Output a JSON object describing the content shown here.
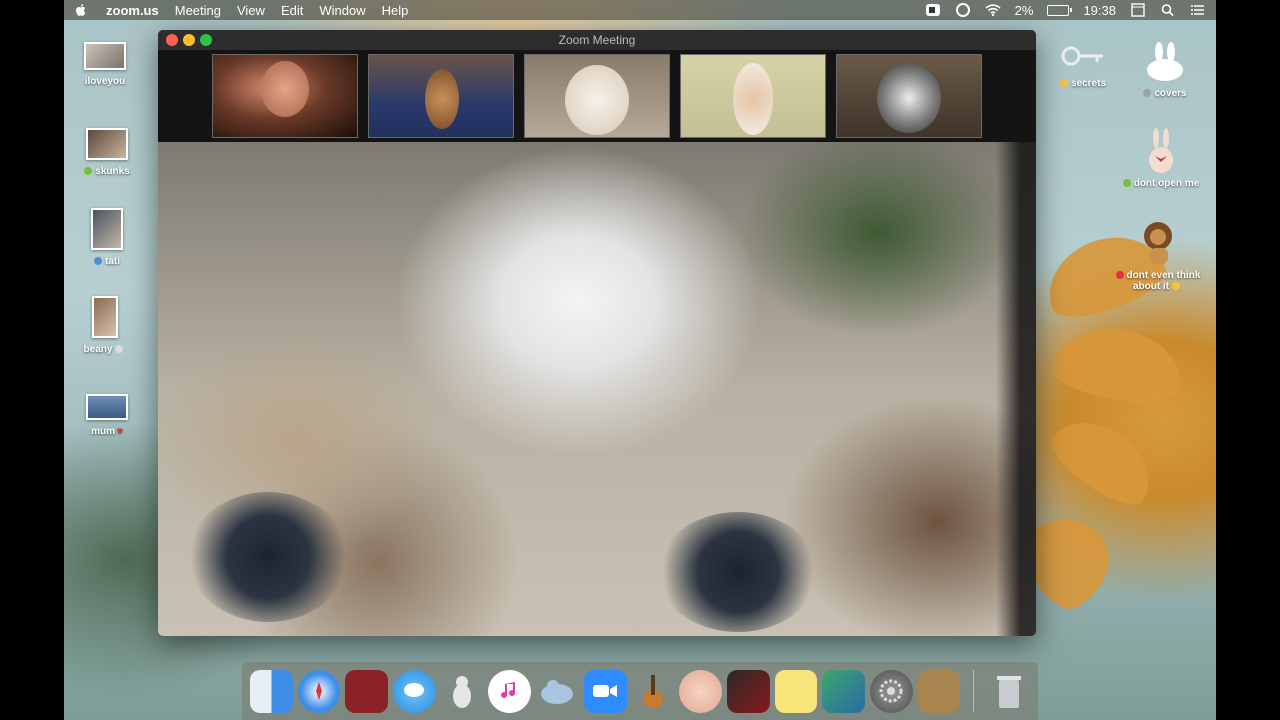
{
  "menubar": {
    "app_name": "zoom.us",
    "items": [
      "Meeting",
      "View",
      "Edit",
      "Window",
      "Help"
    ],
    "battery": "2%",
    "time": "19:38"
  },
  "window": {
    "title": "Zoom Meeting"
  },
  "desktop_icons_left": [
    {
      "label": "iloveyou"
    },
    {
      "label": "skunks"
    },
    {
      "label": "tati"
    },
    {
      "label": "beany"
    },
    {
      "label": "mum"
    }
  ],
  "desktop_icons_right": [
    {
      "label": "secrets"
    },
    {
      "label": "covers"
    },
    {
      "label": "dont open me"
    },
    {
      "label": "dont even think about it"
    }
  ],
  "dock_apps": [
    {
      "name": "finder-icon"
    },
    {
      "name": "safari-icon"
    },
    {
      "name": "photo-booth-icon"
    },
    {
      "name": "messages-icon"
    },
    {
      "name": "unicorn-app-icon"
    },
    {
      "name": "itunes-icon"
    },
    {
      "name": "seal-app-icon"
    },
    {
      "name": "zoom-icon"
    },
    {
      "name": "garageband-icon"
    },
    {
      "name": "face-app-icon"
    },
    {
      "name": "photo-app-icon"
    },
    {
      "name": "stickies-icon"
    },
    {
      "name": "preview-icon"
    },
    {
      "name": "system-preferences-icon"
    },
    {
      "name": "contacts-icon"
    },
    {
      "name": "trash-icon"
    }
  ],
  "colors": {
    "close": "#fe5f57",
    "minimize": "#febc2e",
    "maximize": "#28c840"
  }
}
